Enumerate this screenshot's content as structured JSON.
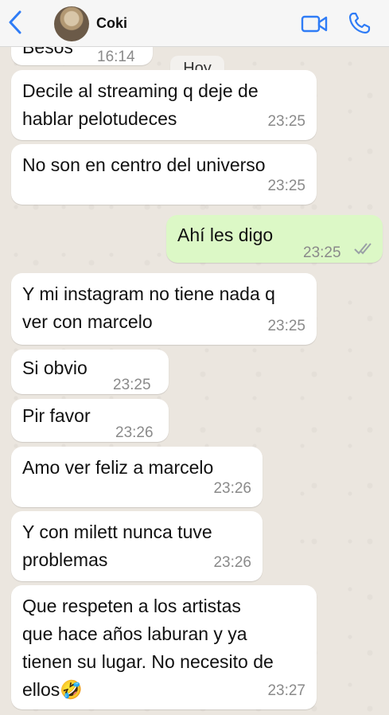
{
  "header": {
    "contact_name": "Coki"
  },
  "day_label": "Hoy",
  "messages": [
    {
      "dir": "in",
      "text": "Besos",
      "time": "16:14"
    },
    {
      "dir": "in",
      "text": "Decile al streaming q deje de hablar pelotudeces",
      "line1": "Decile al streaming q deje de",
      "line2": "hablar pelotudeces",
      "time": "23:25"
    },
    {
      "dir": "in",
      "text": "No son en centro del universo",
      "time": "23:25"
    },
    {
      "dir": "out",
      "text": "Ahí les digo",
      "time": "23:25",
      "status": "read"
    },
    {
      "dir": "in",
      "text": "Y mi instagram no tiene nada q ver con marcelo",
      "line1": "Y mi instagram no tiene nada q",
      "line2": "ver con marcelo",
      "time": "23:25"
    },
    {
      "dir": "in",
      "text": "Si obvio",
      "time": "23:25"
    },
    {
      "dir": "in",
      "text": "Pir favor",
      "time": "23:26"
    },
    {
      "dir": "in",
      "text": "Amo ver feliz a marcelo",
      "time": "23:26"
    },
    {
      "dir": "in",
      "text": "Y con milett nunca tuve problemas",
      "line1": "Y con milett nunca tuve",
      "line2": "problemas",
      "time": "23:26"
    },
    {
      "dir": "in",
      "text": "Que respeten a los artistas que hace años laburan y ya tienen su lugar. No necesito de ellos🤣",
      "line1": "Que respeten a los artistas",
      "line2": "que hace años laburan y ya",
      "line3": "tienen su lugar. No necesito de",
      "line4": "ellos🤣",
      "time": "23:27"
    }
  ],
  "colors": {
    "incoming_bubble": "#ffffff",
    "outgoing_bubble": "#dcf8c6",
    "accent": "#2f7cf6",
    "read_ticks": "#9aa0a6"
  },
  "icons": [
    "back-chevron-icon",
    "contact-avatar",
    "video-call-icon",
    "phone-call-icon",
    "double-check-icon"
  ]
}
